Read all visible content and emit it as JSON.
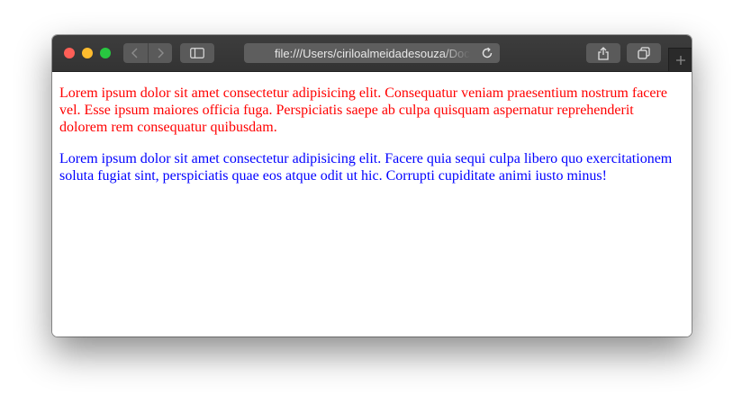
{
  "browser": {
    "address_url": "file:///Users/cirilo​almeidadesouza/Doc",
    "icons": {
      "back": "chevron-left-icon",
      "forward": "chevron-right-icon",
      "sidebar": "sidebar-icon",
      "reload": "reload-icon",
      "share": "share-icon",
      "tabs": "tabs-overview-icon",
      "new_tab": "plus-icon"
    },
    "colors": {
      "toolbar": "#353535",
      "close": "#fe5f57",
      "minimize": "#febc2e",
      "zoom": "#28c840"
    }
  },
  "page": {
    "paragraphs": [
      {
        "text": "Lorem ipsum dolor sit amet consectetur adipisicing elit. Consequatur veniam praesentium nostrum facere vel. Esse ipsum maiores officia fuga. Perspiciatis saepe ab culpa quisquam aspernatur reprehenderit dolorem rem consequatur quibusdam.",
        "color": "#ff0000"
      },
      {
        "text": "Lorem ipsum dolor sit amet consectetur adipisicing elit. Facere quia sequi culpa libero quo exercitationem soluta fugiat sint, perspiciatis quae eos atque odit ut hic. Corrupti cupiditate animi iusto minus!",
        "color": "#0000ff"
      }
    ]
  }
}
